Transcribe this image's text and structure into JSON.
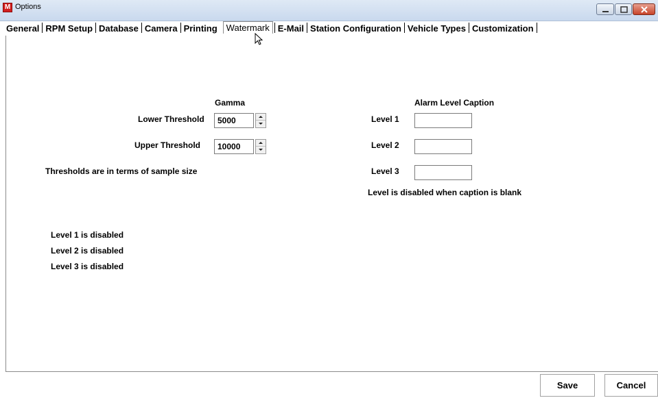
{
  "window": {
    "title": "Options",
    "app_icon_letter": "M",
    "controls": {
      "minimize": "minimize",
      "maximize": "maximize",
      "close": "close"
    }
  },
  "tabs": [
    {
      "label": "General",
      "active": false
    },
    {
      "label": "RPM Setup",
      "active": false
    },
    {
      "label": "Database",
      "active": false
    },
    {
      "label": "Camera",
      "active": false
    },
    {
      "label": "Printing",
      "active": false
    },
    {
      "label": "Watermark",
      "active": true
    },
    {
      "label": "E-Mail",
      "active": false
    },
    {
      "label": "Station Configuration",
      "active": false
    },
    {
      "label": "Vehicle Types",
      "active": false
    },
    {
      "label": "Customization",
      "active": false
    }
  ],
  "gamma": {
    "heading": "Gamma",
    "lower_label": "Lower Threshold",
    "lower_value": "5000",
    "upper_label": "Upper Threshold",
    "upper_value": "10000",
    "note": "Thresholds are in terms of sample size"
  },
  "alarm": {
    "heading": "Alarm Level Caption",
    "levels": [
      {
        "label": "Level 1",
        "value": ""
      },
      {
        "label": "Level 2",
        "value": ""
      },
      {
        "label": "Level 3",
        "value": ""
      }
    ],
    "note": "Level is disabled when caption is blank"
  },
  "status": [
    "Level 1 is disabled",
    "Level 2 is disabled",
    "Level 3 is disabled"
  ],
  "buttons": {
    "save": "Save",
    "cancel": "Cancel"
  },
  "colors": {
    "close_button": "#c8442a",
    "app_icon": "#d21f1f",
    "title_bar": "#dfe9f5"
  }
}
